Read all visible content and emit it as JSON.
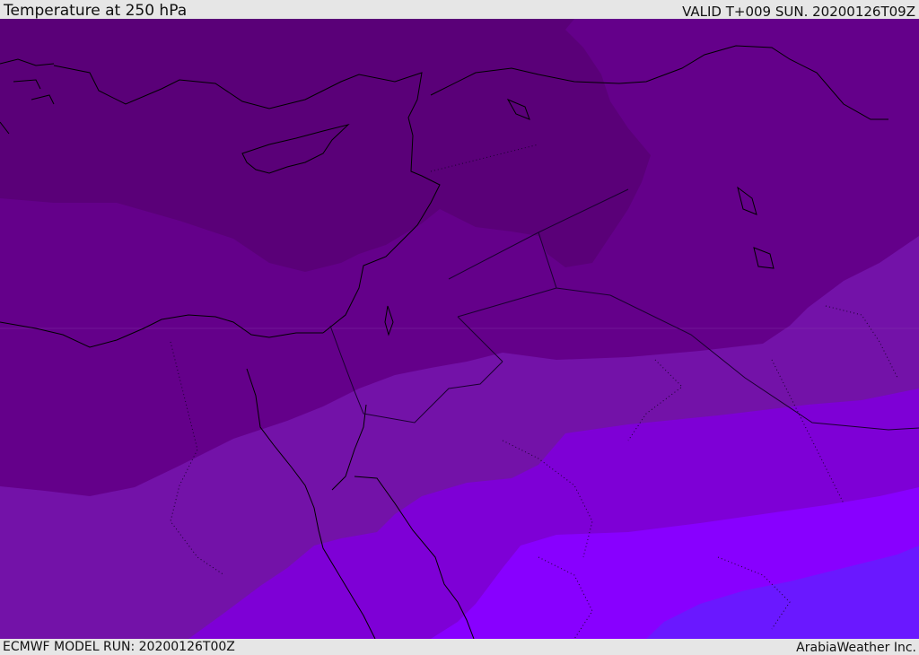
{
  "header": {
    "title": "Temperature at 250 hPa",
    "valid_time": "VALID T+009 SUN. 20200126T09Z"
  },
  "footer": {
    "model_run": "ECMWF MODEL RUN: 20200126T00Z",
    "credit": "ArabiaWeather Inc."
  },
  "map": {
    "colors": {
      "band_1": "#5a0078",
      "band_2": "#64008a",
      "band_3": "#7312a8",
      "band_4": "#7e00d6",
      "band_5": "#8800ff",
      "band_6": "#6a18ff",
      "coastline": "#000000",
      "border": "#1a0030"
    }
  }
}
